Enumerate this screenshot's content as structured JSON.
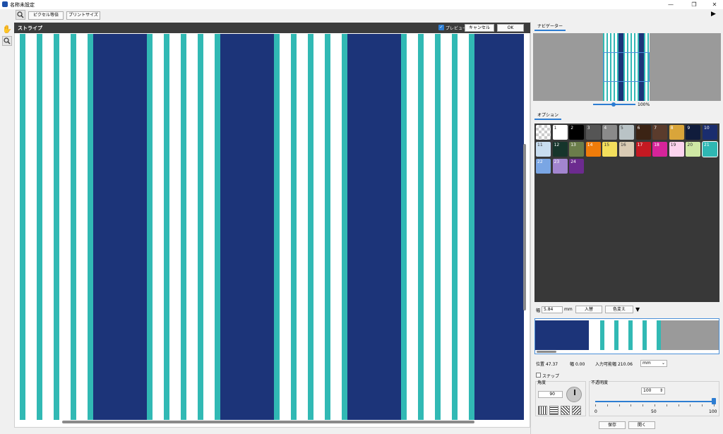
{
  "window": {
    "title": "名称未設定"
  },
  "toolbar": {
    "pixel_label": "ピクセル等倍",
    "print_label": "プリントサイズ"
  },
  "canvas": {
    "title": "ストライプ",
    "preview_label": "プレビュー",
    "preview_checked": true,
    "cancel_label": "キャンセル",
    "ok_label": "OK"
  },
  "navigator": {
    "tab_label": "ナビゲーター",
    "zoom": "100%"
  },
  "options": {
    "tab_label": "オプション"
  },
  "palette": [
    {
      "n": "",
      "color": "transparent"
    },
    {
      "n": "1",
      "color": "#ffffff"
    },
    {
      "n": "2",
      "color": "#000000"
    },
    {
      "n": "3",
      "color": "#555555"
    },
    {
      "n": "4",
      "color": "#8a8a8a"
    },
    {
      "n": "5",
      "color": "#b9c3c6"
    },
    {
      "n": "6",
      "color": "#3b2314"
    },
    {
      "n": "7",
      "color": "#5a3b2c"
    },
    {
      "n": "8",
      "color": "#d9a53a"
    },
    {
      "n": "9",
      "color": "#101c3c"
    },
    {
      "n": "10",
      "color": "#1a2d6e"
    },
    {
      "n": "11",
      "color": "#c8ddf0"
    },
    {
      "n": "12",
      "color": "#16352b"
    },
    {
      "n": "13",
      "color": "#6b7d4b"
    },
    {
      "n": "14",
      "color": "#f07c0a"
    },
    {
      "n": "15",
      "color": "#f3df5c"
    },
    {
      "n": "16",
      "color": "#d9cbb4"
    },
    {
      "n": "17",
      "color": "#c41922"
    },
    {
      "n": "18",
      "color": "#d6249a"
    },
    {
      "n": "19",
      "color": "#fbd3ee"
    },
    {
      "n": "20",
      "color": "#cfe8a4"
    },
    {
      "n": "21",
      "color": "#2fb7b3"
    },
    {
      "n": "22",
      "color": "#7aa6e4"
    },
    {
      "n": "23",
      "color": "#a285cf"
    },
    {
      "n": "24",
      "color": "#6c2b8f"
    }
  ],
  "width_row": {
    "label": "幅",
    "value": "5.84",
    "unit": "mm",
    "insert_label": "入替",
    "color_change_label": "色変え"
  },
  "position": {
    "pos_label": "位置",
    "pos_value": "47.37",
    "width_label": "幅",
    "width_value": "0.00",
    "avail_label": "入力可能幅",
    "avail_value": "210.06",
    "unit": "mm"
  },
  "snap": {
    "label": "スナップ",
    "checked": false
  },
  "angle": {
    "label": "角度",
    "value": "90"
  },
  "opacity": {
    "label": "不透明度",
    "value": "100",
    "level": 100,
    "ticks": [
      "0",
      "50",
      "100"
    ]
  },
  "actions": {
    "save_label": "保存",
    "open_label": "開く"
  },
  "colors": {
    "navy": "#1c3479",
    "teal": "#31b9b4",
    "white": "#ffffff"
  },
  "stripes": [
    {
      "c": "teal"
    },
    {
      "c": "white"
    },
    {
      "c": "teal"
    },
    {
      "c": "white"
    },
    {
      "c": "teal"
    },
    {
      "c": "white"
    },
    {
      "c": "teal"
    },
    {
      "c": "white"
    },
    {
      "c": "teal"
    },
    {
      "c": "navy"
    }
  ]
}
